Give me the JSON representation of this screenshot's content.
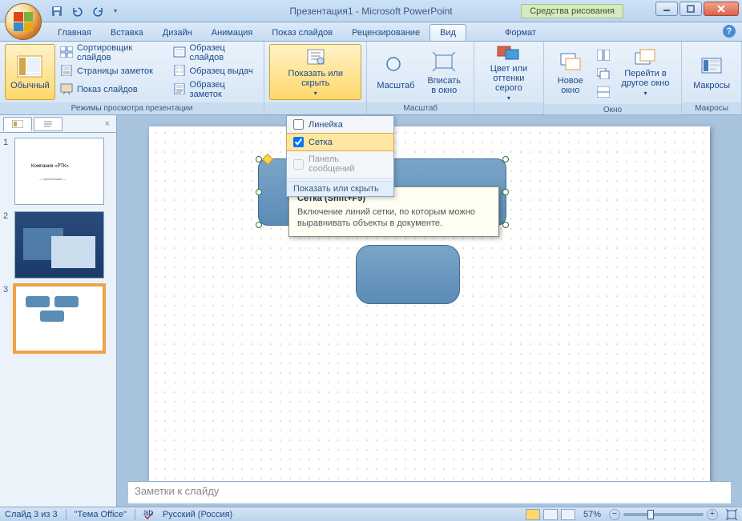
{
  "title": "Презентация1 - Microsoft PowerPoint",
  "drawing_tools": "Средства рисования",
  "tabs": {
    "home": "Главная",
    "insert": "Вставка",
    "design": "Дизайн",
    "animation": "Анимация",
    "slideshow": "Показ слайдов",
    "review": "Рецензирование",
    "view": "Вид",
    "format": "Формат"
  },
  "ribbon": {
    "normal": "Обычный",
    "slide_sorter": "Сортировщик слайдов",
    "notes_page": "Страницы заметок",
    "slide_show": "Показ слайдов",
    "group_views": "Режимы просмотра презентации",
    "slide_master": "Образец слайдов",
    "handout_master": "Образец выдач",
    "notes_master": "Образец заметок",
    "show_hide": "Показать или скрыть",
    "zoom": "Масштаб",
    "fit_window": "Вписать в окно",
    "group_zoom": "Масштаб",
    "color_gray": "Цвет или оттенки серого",
    "new_window": "Новое окно",
    "switch_window": "Перейти в другое окно",
    "group_window": "Окно",
    "macros": "Макросы",
    "group_macros": "Макросы"
  },
  "dropdown": {
    "ruler": "Линейка",
    "grid": "Сетка",
    "message_bar": "Панель сообщений",
    "footer": "Показать или скрыть"
  },
  "tooltip": {
    "title": "Сетка (Shift+F9)",
    "body": "Включение линий сетки, по которым можно выравнивать объекты в документе."
  },
  "notes_placeholder": "Заметки к слайду",
  "status": {
    "slide_info": "Слайд 3 из 3",
    "theme": "\"Тема Office\"",
    "language": "Русский (Россия)",
    "zoom": "57%"
  },
  "slides": {
    "count": 3,
    "selected": 3
  }
}
